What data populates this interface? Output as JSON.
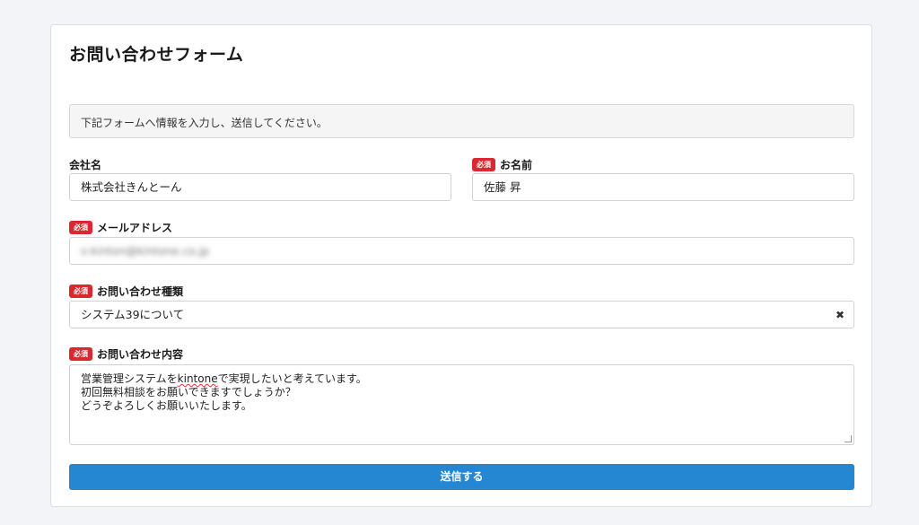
{
  "form": {
    "title": "お問い合わせフォーム",
    "notice": "下記フォームへ情報を入力し、送信してください。",
    "required_badge": "必須",
    "company": {
      "label": "会社名",
      "value": "株式会社きんとーん"
    },
    "name": {
      "label": "お名前",
      "value": "佐藤 昇"
    },
    "email": {
      "label": "メールアドレス",
      "value": "s-kinton@kintone.co.jp"
    },
    "inquiry_type": {
      "label": "お問い合わせ種類",
      "value": "システム39について",
      "clear_icon": "✖"
    },
    "content": {
      "label": "お問い合わせ内容",
      "line1_pre": "営業管理システムを",
      "line1_word": "kintone",
      "line1_post": "で実現したいと考えています。",
      "line2": "初回無料相談をお願いできますでしょうか？",
      "line3": "どうぞよろしくお願いいたします。"
    },
    "submit_label": "送信する"
  }
}
